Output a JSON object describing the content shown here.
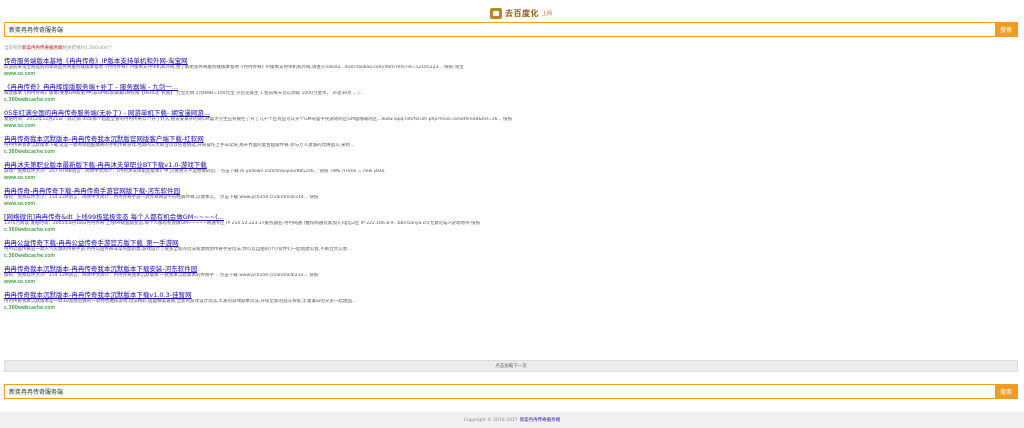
{
  "logo": {
    "name": "去百度化",
    "sub": "上网"
  },
  "search": {
    "value": "新奕冉冉传奇服务端",
    "button": "搜索"
  },
  "stats": {
    "prefix": "当前找到",
    "keyword": "新奕冉冉传奇服务端",
    "suffix": "相关结果约1,000,000个"
  },
  "results": [
    {
      "title": "传奇服务端版本基地《冉冉传奇》IP版本支持单机和外网-淘宝网",
      "desc": "欢迎前来淘宝网选购热销商品传奇服务端版本基地《冉冉传奇》IP版本支持单机和外网,想了解更多传奇服务端版本基地《冉冉传奇》IP版本支持单机和外网,请进入nokia2...item.taobao.com/item.htm?id=52105223... 快照-淘宝",
      "url": "www.so.com"
    },
    {
      "title": "《冉冉传奇》冉冉辉煌版服务端+补丁 - 服务器端 - 九剑一...",
      "desc": "辉煌版本《冉冉传奇》版本(要塞GM权限)中(非GM权限满满GM权限【HERO】权限】 元宝比例 1元RMB=100元宝 沙巴克城主 1 会员每天可以领取 1000万金币， 声望30点 。\\...",
      "url": "c.360webcache.com"
    },
    {
      "title": "05年红满全国的冉冉传奇服务端(无补丁) - 网游单机下载- 網宝漫网游...",
      "desc": "发贴时间：2012年12月21日 - 跃迁骑 05年那个超超全省的冉冉传奇公??开了好久,擅去安卓开的同GM喜大学生应有被拦了开了几十个区有些可以买个GM号盛平民游戏的区GM盛嘟喃的区...www.iopq.net/forum.php?mod=viewthread&tid=16... 快照",
      "url": "www.so.com"
    },
    {
      "title": "冉冉传奇我本沉默版本-冉冉传奇我本沉默版官网版客户端下载-红软网",
      "desc": "冉冉传奇我本沉默版本下载,这是一款简单超酷爆刷的手机传奇游戏,经典的三大职业可以任意挑选,开局操作上手非常快,那开界面的复古超级传奇,参与万人攻城的比拼战斗,采用...",
      "url": "c.360webcache.com"
    },
    {
      "title": "冉冉沐夫第职业版本最新版下载-冉冉沐夫单职业BT下载v1.0-游戏下载",
      "desc": "游戏：免费软件大小：257.97MB语言：简体中文简介：《冉冉沐夫单职业版本》中,只要进入不选想要的切... 点击下载 m.yxdown.com/shouyou/885256... 快照 TIME rITime = new Date.",
      "url": "www.so.com"
    },
    {
      "title": "冉冉传奇-冉冉传奇下载-冉冉传奇手游官网版下载-河东软件园",
      "desc": "版权：免费软件大小：154.13M语言：简体中文简介：冉冉传奇手游一款传奇网游不的经典传奇,以我本沉、 点击下载 www.pc0359.cn/android/214... 快照",
      "url": "www.so.com"
    },
    {
      "title": "[网络微讯]冉冉传奇&dt 上线99极猛极变态 每个人都有机会做GM~~~~(...",
      "desc": "1375万阅读 发贴时间：2005年8月18日冉冉传奇 上线99级猛级变态,每个人都有机会做GM~~~~~网通专区 IP 210.52.223.17服务器名:冉冉网通 (推荐网通玩家加入)电信2区 IP 222.186.8.9...bbs.tianya.cn/无意论坛>游戏地带-快照",
      "url": "c.360webcache.com"
    },
    {
      "title": "冉冉公益传奇下载-冉冉公益传奇手游官方版下载_第一手游网",
      "desc": "冉冉公益传奇是一款人气火爆的传奇手游,冉冉公益传奇非常热血刺激,游戏设计了很多全新的玩法和激情仿传奇手游玩法,你可以自由的介小伙伴们一起组建公会,不断壮大公会...",
      "url": "c.360webcache.com"
    },
    {
      "title": "冉冉传奇我本沉默版本-冉冉传奇我本沉默版本下载安装-河东软件园",
      "desc": "版权：免费软件大小：154.13M语言：简体中文简介：冉冉传奇我本沉默版本 一款我本沉默版本的传奇手... 点击下载 www.pc0359.cn/android/212... 快照",
      "url": "www.so.com"
    },
    {
      "title": "冉冉传奇我本沉默版本-冉冉传奇我本沉默版本下载v1.0.3-佳暂网",
      "desc": "冉冉传奇我本沉默版本是一款3D宽频且群的一款特色魔技游戏,玩法精彩,画面精美逼真,全新的游戏设计玩法,丰富的游戏剧本玩法,开局全新的战斗系统,丰富兼日的兄弟一起建国...",
      "url": "c.360webcache.com"
    }
  ],
  "nextpage": "点击加载下一页",
  "footer": {
    "copyright": "Copyright © 2016-2017",
    "link": "新奕冉冉传奇服务端"
  },
  "colors": {
    "accent": "#f29d1f",
    "link": "#1a0dab",
    "url": "#008000"
  }
}
